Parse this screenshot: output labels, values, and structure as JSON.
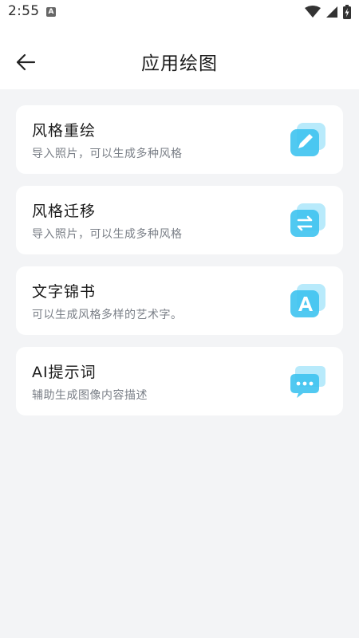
{
  "status_bar": {
    "time": "2:55",
    "app_badge": "A"
  },
  "header": {
    "title": "应用绘图"
  },
  "cards": [
    {
      "title": "风格重绘",
      "subtitle": "导入照片，可以生成多种风格",
      "icon": "pen-edit-icon"
    },
    {
      "title": "风格迁移",
      "subtitle": "导入照片，可以生成多种风格",
      "icon": "swap-arrows-icon"
    },
    {
      "title": "文字锦书",
      "subtitle": "可以生成风格多样的艺术字。",
      "icon": "letter-a-icon"
    },
    {
      "title": "AI提示词",
      "subtitle": "辅助生成图像内容描述",
      "icon": "chat-bubble-icon"
    }
  ],
  "colors": {
    "background": "#f3f4f6",
    "card": "#ffffff",
    "icon_light": "#b8eafb",
    "icon_main": "#3ec3f0"
  }
}
